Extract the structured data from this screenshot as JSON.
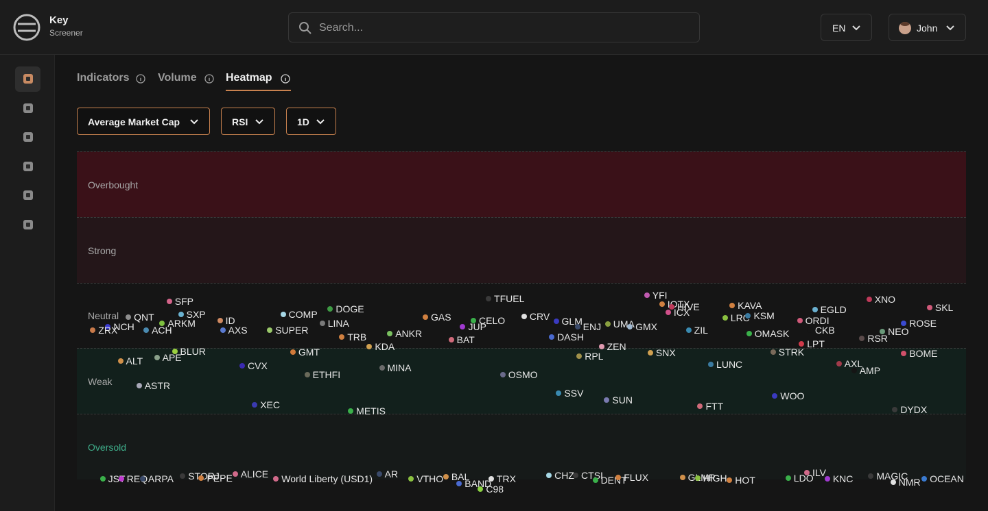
{
  "header": {
    "brand_title": "Key",
    "brand_sub": "Screener",
    "search_placeholder": "Search...",
    "language": "EN",
    "user_name": "John"
  },
  "sidebar": {
    "items": [
      {
        "name": "sidebar-item-home",
        "active": true
      },
      {
        "name": "sidebar-item-charts",
        "active": false
      },
      {
        "name": "sidebar-item-camera",
        "active": false
      },
      {
        "name": "sidebar-item-grid",
        "active": false
      },
      {
        "name": "sidebar-item-dollar",
        "active": false
      },
      {
        "name": "sidebar-item-lock",
        "active": false
      }
    ]
  },
  "tabs": [
    {
      "label": "Indicators",
      "active": false
    },
    {
      "label": "Volume",
      "active": false
    },
    {
      "label": "Heatmap",
      "active": true
    }
  ],
  "filters": {
    "market_cap": "Average Market Cap",
    "indicator": "RSI",
    "timeframe": "1D"
  },
  "heatmap": {
    "bands": [
      {
        "label": "Overbought",
        "color": "#3a1118",
        "text_color": "#a8a8a8",
        "range": [
          80,
          100
        ]
      },
      {
        "label": "Strong",
        "color": "#241619",
        "text_color": "#a8a8a8",
        "range": [
          60,
          80
        ]
      },
      {
        "label": "Neutral",
        "color": "#151515",
        "text_color": "#a8a8a8",
        "range": [
          40,
          60
        ]
      },
      {
        "label": "Weak",
        "color": "#12201c",
        "text_color": "#a8a8a8",
        "range": [
          20,
          40
        ]
      },
      {
        "label": "Oversold",
        "color": "#161a19",
        "text_color": "#3fae8a",
        "range": [
          0,
          20
        ]
      }
    ],
    "coins": [
      {
        "s": "SFP",
        "x": 0.104,
        "rsi": 54.3,
        "c": "#d4648a"
      },
      {
        "s": "SXP",
        "x": 0.117,
        "rsi": 50.4,
        "c": "#6ab2d0"
      },
      {
        "s": "QNT",
        "x": 0.058,
        "rsi": 49.5,
        "c": "#8e8e8e"
      },
      {
        "s": "ARKM",
        "x": 0.096,
        "rsi": 47.7,
        "c": "#7ec040"
      },
      {
        "s": "ID",
        "x": 0.161,
        "rsi": 48.5,
        "c": "#d08a62"
      },
      {
        "s": "COMP",
        "x": 0.232,
        "rsi": 50.4,
        "c": "#a6d8e6"
      },
      {
        "s": "DOGE",
        "x": 0.285,
        "rsi": 52.0,
        "c": "#3e9a44"
      },
      {
        "s": "LINA",
        "x": 0.276,
        "rsi": 47.5,
        "c": "#7a7a7a"
      },
      {
        "s": "NCH",
        "x": 0.035,
        "rsi": 46.5,
        "c": "#3a3ad0"
      },
      {
        "s": "ZRX",
        "x": 0.018,
        "rsi": 45.5,
        "c": "#c97a4a"
      },
      {
        "s": "ACH",
        "x": 0.078,
        "rsi": 45.5,
        "c": "#4a8ab0"
      },
      {
        "s": "AXS",
        "x": 0.164,
        "rsi": 45.5,
        "c": "#5a7ad0"
      },
      {
        "s": "SUPER",
        "x": 0.217,
        "rsi": 45.5,
        "c": "#9ac86a"
      },
      {
        "s": "TRB",
        "x": 0.298,
        "rsi": 43.5,
        "c": "#d08040"
      },
      {
        "s": "KDA",
        "x": 0.329,
        "rsi": 40.6,
        "c": "#d0a050"
      },
      {
        "s": "ANKR",
        "x": 0.352,
        "rsi": 44.5,
        "c": "#7ac060"
      },
      {
        "s": "GAS",
        "x": 0.392,
        "rsi": 49.5,
        "c": "#d08040"
      },
      {
        "s": "TFUEL",
        "x": 0.463,
        "rsi": 55.2,
        "c": "#3a3a3a"
      },
      {
        "s": "CELO",
        "x": 0.446,
        "rsi": 48.5,
        "c": "#3ab04a"
      },
      {
        "s": "JUP",
        "x": 0.434,
        "rsi": 46.6,
        "c": "#a03ad0"
      },
      {
        "s": "BAT",
        "x": 0.421,
        "rsi": 42.6,
        "c": "#d06a7a"
      },
      {
        "s": "CRV",
        "x": 0.503,
        "rsi": 49.7,
        "c": "#e0e0e0"
      },
      {
        "s": "GLM",
        "x": 0.539,
        "rsi": 48.2,
        "c": "#3a3ac0"
      },
      {
        "s": "ENJ",
        "x": 0.563,
        "rsi": 46.6,
        "c": "#3a4a6a"
      },
      {
        "s": "UMA",
        "x": 0.597,
        "rsi": 47.4,
        "c": "#8aa040"
      },
      {
        "s": "GMX",
        "x": 0.622,
        "rsi": 46.6,
        "c": "#a0b8d0"
      },
      {
        "s": "DASH",
        "x": 0.534,
        "rsi": 43.5,
        "c": "#4a6ad0"
      },
      {
        "s": "ZEN",
        "x": 0.59,
        "rsi": 40.6,
        "c": "#e09ab0"
      },
      {
        "s": "YFI",
        "x": 0.641,
        "rsi": 56.1,
        "c": "#c05ab0"
      },
      {
        "s": "IOTX",
        "x": 0.658,
        "rsi": 53.5,
        "c": "#d08040"
      },
      {
        "s": "HIVE",
        "x": 0.669,
        "rsi": 52.6,
        "c": "#c03a5a"
      },
      {
        "s": "ICX",
        "x": 0.665,
        "rsi": 51.0,
        "c": "#d0508a"
      },
      {
        "s": "ZIL",
        "x": 0.688,
        "rsi": 45.5,
        "c": "#3a8ab0"
      },
      {
        "s": "KAVA",
        "x": 0.737,
        "rsi": 53.0,
        "c": "#d08040"
      },
      {
        "s": "LRC",
        "x": 0.729,
        "rsi": 49.2,
        "c": "#8ac040"
      },
      {
        "s": "KSM",
        "x": 0.755,
        "rsi": 50.0,
        "c": "#3a7aa0"
      },
      {
        "s": "OMASK",
        "x": 0.756,
        "rsi": 44.4,
        "c": "#3ab04a"
      },
      {
        "s": "EGLD",
        "x": 0.83,
        "rsi": 51.7,
        "c": "#6ab0d0"
      },
      {
        "s": "ORDI",
        "x": 0.813,
        "rsi": 48.5,
        "c": "#d05a7a"
      },
      {
        "s": "CKB",
        "x": 0.824,
        "rsi": 45.5,
        "c": "#151515"
      },
      {
        "s": "XNO",
        "x": 0.891,
        "rsi": 55.0,
        "c": "#c03a5a"
      },
      {
        "s": "SKL",
        "x": 0.959,
        "rsi": 52.4,
        "c": "#d05a7a"
      },
      {
        "s": "ROSE",
        "x": 0.93,
        "rsi": 47.5,
        "c": "#3a4ad0"
      },
      {
        "s": "NEO",
        "x": 0.906,
        "rsi": 45.0,
        "c": "#6a9a7a"
      },
      {
        "s": "RSR",
        "x": 0.883,
        "rsi": 43.0,
        "c": "#5a4a4a"
      },
      {
        "s": "LPT",
        "x": 0.815,
        "rsi": 41.4,
        "c": "#d03a4a"
      },
      {
        "s": "STRK",
        "x": 0.783,
        "rsi": 38.9,
        "c": "#7a6a5a"
      },
      {
        "s": "BOME",
        "x": 0.93,
        "rsi": 38.5,
        "c": "#d0506a"
      },
      {
        "s": "AXL",
        "x": 0.857,
        "rsi": 35.2,
        "c": "#a03a4a"
      },
      {
        "s": "AMP",
        "x": 0.874,
        "rsi": 33.1,
        "c": "#151515"
      },
      {
        "s": "LUNC",
        "x": 0.713,
        "rsi": 35.1,
        "c": "#3a7aa0"
      },
      {
        "s": "WOO",
        "x": 0.785,
        "rsi": 25.4,
        "c": "#3a3ac0"
      },
      {
        "s": "DYDX",
        "x": 0.92,
        "rsi": 21.2,
        "c": "#3a3a3a"
      },
      {
        "s": "FTT",
        "x": 0.701,
        "rsi": 22.3,
        "c": "#d06a7a"
      },
      {
        "s": "SNX",
        "x": 0.645,
        "rsi": 38.7,
        "c": "#d0a050"
      },
      {
        "s": "RPL",
        "x": 0.565,
        "rsi": 37.6,
        "c": "#a0904a"
      },
      {
        "s": "SUN",
        "x": 0.596,
        "rsi": 24.3,
        "c": "#7a7ab0"
      },
      {
        "s": "SSV",
        "x": 0.542,
        "rsi": 26.4,
        "c": "#3a8ab0"
      },
      {
        "s": "OSMO",
        "x": 0.479,
        "rsi": 32.0,
        "c": "#6a6a8a"
      },
      {
        "s": "MINA",
        "x": 0.343,
        "rsi": 34.1,
        "c": "#6a6a6a"
      },
      {
        "s": "GMT",
        "x": 0.243,
        "rsi": 38.9,
        "c": "#d07a3a"
      },
      {
        "s": "ETHFI",
        "x": 0.259,
        "rsi": 32.0,
        "c": "#6a6a5a"
      },
      {
        "s": "CVX",
        "x": 0.186,
        "rsi": 34.6,
        "c": "#3a2ab0"
      },
      {
        "s": "XEC",
        "x": 0.2,
        "rsi": 22.8,
        "c": "#3a3ab0"
      },
      {
        "s": "METIS",
        "x": 0.308,
        "rsi": 20.9,
        "c": "#3ab04a"
      },
      {
        "s": "BLUR",
        "x": 0.11,
        "rsi": 39.0,
        "c": "#9ad040"
      },
      {
        "s": "APE",
        "x": 0.09,
        "rsi": 37.2,
        "c": "#8aa08a"
      },
      {
        "s": "ALT",
        "x": 0.049,
        "rsi": 36.1,
        "c": "#d0904a"
      },
      {
        "s": "ASTR",
        "x": 0.07,
        "rsi": 28.5,
        "c": "#a8a8b8"
      },
      {
        "s": "JST",
        "x": 0.029,
        "rsi": 0.2,
        "c": "#3ab04a"
      },
      {
        "s": "REQ",
        "x": 0.05,
        "rsi": 0.2,
        "c": "#c03ad0"
      },
      {
        "s": "ARPA",
        "x": 0.074,
        "rsi": 0.2,
        "c": "#3a4a6a"
      },
      {
        "s": "STORJ",
        "x": 0.119,
        "rsi": 1.1,
        "c": "#3a3a3a"
      },
      {
        "s": "PEPE",
        "x": 0.14,
        "rsi": 0.5,
        "c": "#d08040"
      },
      {
        "s": "ALICE",
        "x": 0.178,
        "rsi": 1.6,
        "c": "#d06a8a"
      },
      {
        "s": "World Liberty (USD1)",
        "x": 0.224,
        "rsi": 0.2,
        "c": "#d06a8a"
      },
      {
        "s": "AR",
        "x": 0.34,
        "rsi": 1.6,
        "c": "#3a4a6a"
      },
      {
        "s": "VTHO",
        "x": 0.376,
        "rsi": 0.2,
        "c": "#8ac040"
      },
      {
        "s": "BAL",
        "x": 0.415,
        "rsi": 0.9,
        "c": "#d0904a"
      },
      {
        "s": "BAND",
        "x": 0.43,
        "rsi": -1.2,
        "c": "#4a6ad0"
      },
      {
        "s": "C98",
        "x": 0.454,
        "rsi": -3.0,
        "c": "#8ad040"
      },
      {
        "s": "TRX",
        "x": 0.466,
        "rsi": 0.2,
        "c": "#e0e0e0"
      },
      {
        "s": "CHZ",
        "x": 0.531,
        "rsi": 1.2,
        "c": "#a6d8e6"
      },
      {
        "s": "CTSI",
        "x": 0.561,
        "rsi": 1.2,
        "c": "#3a3a3a"
      },
      {
        "s": "DENT",
        "x": 0.583,
        "rsi": -0.3,
        "c": "#3ab04a"
      },
      {
        "s": "FLUX",
        "x": 0.609,
        "rsi": 0.7,
        "c": "#d08040"
      },
      {
        "s": "GLMR",
        "x": 0.681,
        "rsi": 0.7,
        "c": "#d0904a"
      },
      {
        "s": "HIGH",
        "x": 0.698,
        "rsi": 0.4,
        "c": "#8ac040"
      },
      {
        "s": "HOT",
        "x": 0.734,
        "rsi": -0.3,
        "c": "#d08040"
      },
      {
        "s": "LDO",
        "x": 0.8,
        "rsi": 0.4,
        "c": "#3ab04a"
      },
      {
        "s": "ILV",
        "x": 0.821,
        "rsi": 2.1,
        "c": "#d06a8a"
      },
      {
        "s": "KNC",
        "x": 0.844,
        "rsi": 0.2,
        "c": "#a03ad0"
      },
      {
        "s": "MAGIC",
        "x": 0.893,
        "rsi": 1.1,
        "c": "#3a3a3a"
      },
      {
        "s": "NMR",
        "x": 0.918,
        "rsi": -0.8,
        "c": "#e0e0e0"
      },
      {
        "s": "OCEAN",
        "x": 0.953,
        "rsi": 0.2,
        "c": "#3a7ad0"
      }
    ]
  }
}
